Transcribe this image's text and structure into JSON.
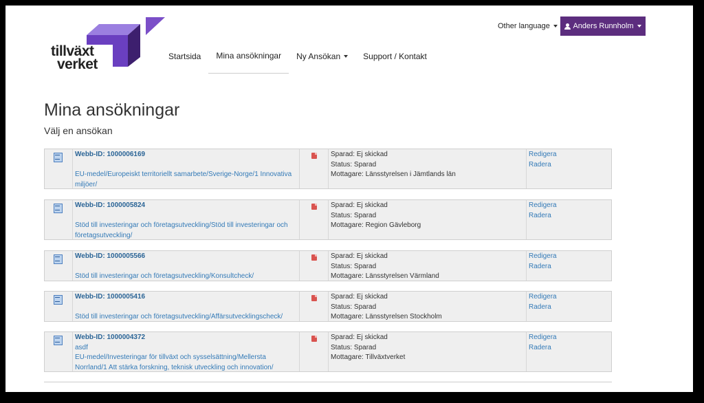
{
  "logo": {
    "line1": "tillväxt",
    "line2": "verket"
  },
  "nav": {
    "items": [
      {
        "label": "Startsida"
      },
      {
        "label": "Mina ansökningar"
      },
      {
        "label": "Ny Ansökan"
      },
      {
        "label": "Support / Kontakt"
      }
    ]
  },
  "header": {
    "language": "Other language",
    "user": "Anders Runnholm"
  },
  "page": {
    "title": "Mina ansökningar",
    "subtitle": "Välj en ansökan"
  },
  "applications": [
    {
      "webbid": "Webb-ID: 1000006169",
      "extra": "",
      "path": "EU-medel/Europeiskt territoriellt samarbete/Sverige-Norge/1 Innovativa miljöer/",
      "sparad": "Sparad: Ej skickad",
      "status": "Status: Sparad",
      "mottagare": "Mottagare: Länsstyrelsen i Jämtlands län",
      "edit": "Redigera",
      "delete": "Radera"
    },
    {
      "webbid": "Webb-ID: 1000005824",
      "extra": "",
      "path": "Stöd till investeringar och företagsutveckling/Stöd till investeringar och företagsutveckling/",
      "sparad": "Sparad: Ej skickad",
      "status": "Status: Sparad",
      "mottagare": "Mottagare: Region Gävleborg",
      "edit": "Redigera",
      "delete": "Radera"
    },
    {
      "webbid": "Webb-ID: 1000005566",
      "extra": "",
      "path": "Stöd till investeringar och företagsutveckling/Konsultcheck/",
      "sparad": "Sparad: Ej skickad",
      "status": "Status: Sparad",
      "mottagare": "Mottagare: Länsstyrelsen Värmland",
      "edit": "Redigera",
      "delete": "Radera"
    },
    {
      "webbid": "Webb-ID: 1000005416",
      "extra": "",
      "path": "Stöd till investeringar och företagsutveckling/Affärsutvecklingscheck/",
      "sparad": "Sparad: Ej skickad",
      "status": "Status: Sparad",
      "mottagare": "Mottagare: Länsstyrelsen Stockholm",
      "edit": "Redigera",
      "delete": "Radera"
    },
    {
      "webbid": "Webb-ID: 1000004372",
      "extra": "asdf",
      "path": "EU-medel/Investeringar för tillväxt och sysselsättning/Mellersta Norrland/1 Att stärka forskning, teknisk utveckling och innovation/",
      "sparad": "Sparad: Ej skickad",
      "status": "Status: Sparad",
      "mottagare": "Mottagare: Tillväxtverket",
      "edit": "Redigera",
      "delete": "Radera"
    }
  ],
  "colors": {
    "brand": "#5c2d7e",
    "logo_purple": "#7b4fc8",
    "link": "#337ab7"
  }
}
